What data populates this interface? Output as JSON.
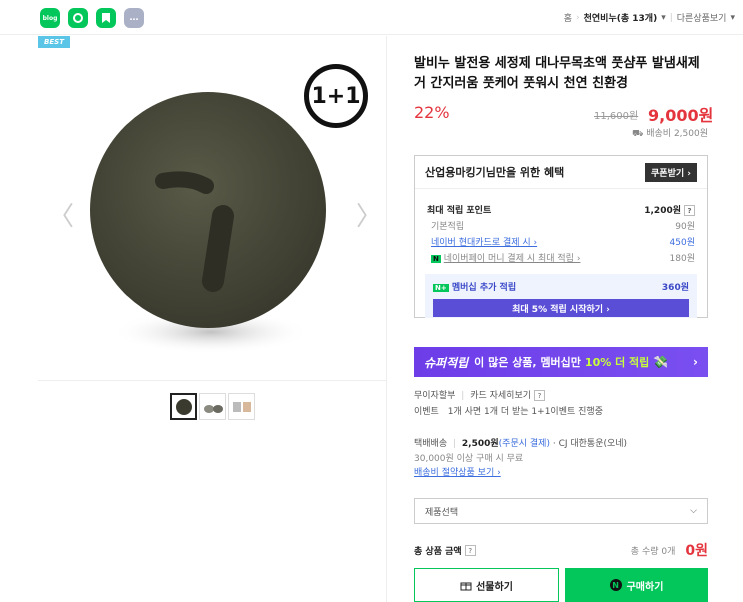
{
  "header": {
    "sns": [
      {
        "name": "blog-icon",
        "glyph": "blog",
        "color": "#03c75a"
      },
      {
        "name": "talk-icon",
        "glyph": "",
        "color": "#03c75a"
      },
      {
        "name": "bookmark-icon",
        "glyph": "",
        "color": "#03c75a"
      },
      {
        "name": "more-icon",
        "glyph": "…",
        "color": "#aab1c6"
      }
    ],
    "breadcrumb": {
      "home": "홈",
      "current": "천연비누(총 13개)",
      "other": "다른상품보기"
    }
  },
  "gallery": {
    "badge": "BEST",
    "promo_badge": "1+1",
    "prev_arrow": "〈",
    "next_arrow": "〉"
  },
  "product": {
    "title": "발비누 발전용 세정제 대나무목초액 풋샴푸 발냄새제거 간지러움 풋케어 풋워시 천연 친환경",
    "discount": "22%",
    "original_price": "11,600원",
    "price": "9,000원",
    "shipping_fee": "배송비 2,500원"
  },
  "benefit": {
    "header": "산업용마킹기님만을 위한 혜택",
    "coupon_button": "쿠폰받기 ›",
    "max_points_label": "최대 적립 포인트",
    "max_points_value": "1,200원",
    "q": "?",
    "rows": [
      {
        "label": "기본적립",
        "value": "90원"
      },
      {
        "label": "네이버 현대카드로 결제 시 ›",
        "value": "450원"
      },
      {
        "label": "네이버페이 머니 결제 시 최대 적립 ›",
        "value": "180원"
      }
    ],
    "membership_label": "멤버십 추가 적립",
    "membership_value": "360원",
    "membership_button": "최대 5% 적립 시작하기 ›"
  },
  "super_banner": {
    "brand": "슈퍼적립",
    "text1": "이 많은 상품, 멤버십만",
    "highlight": "10% 더 적립",
    "arrow": "›"
  },
  "info": {
    "installment": "무이자할부",
    "card_detail": "카드 자세히보기",
    "event_label": "이벤트",
    "event_text": "1개 사면 1개 더 받는 1+1이벤트 진행중"
  },
  "delivery": {
    "label": "택배배송",
    "fee": "2,500원",
    "fee_note": "(주문시 결제)",
    "carrier": "· CJ 대한통운(오네)",
    "free_note": "30,000원 이상 구매 시 무료",
    "saving_link": "배송비 절약상품 보기 ›"
  },
  "option": {
    "placeholder": "제품선택",
    "chevron": "⌵"
  },
  "total": {
    "label": "총 상품 금액",
    "q": "?",
    "count": "총 수량 0개",
    "amount": "0원"
  },
  "actions": {
    "gift": "선물하기",
    "buy": "구매하기"
  },
  "colors": {
    "accent_green": "#03c75a",
    "price_red": "#e4343d",
    "super_purple": "#6d3de8"
  }
}
